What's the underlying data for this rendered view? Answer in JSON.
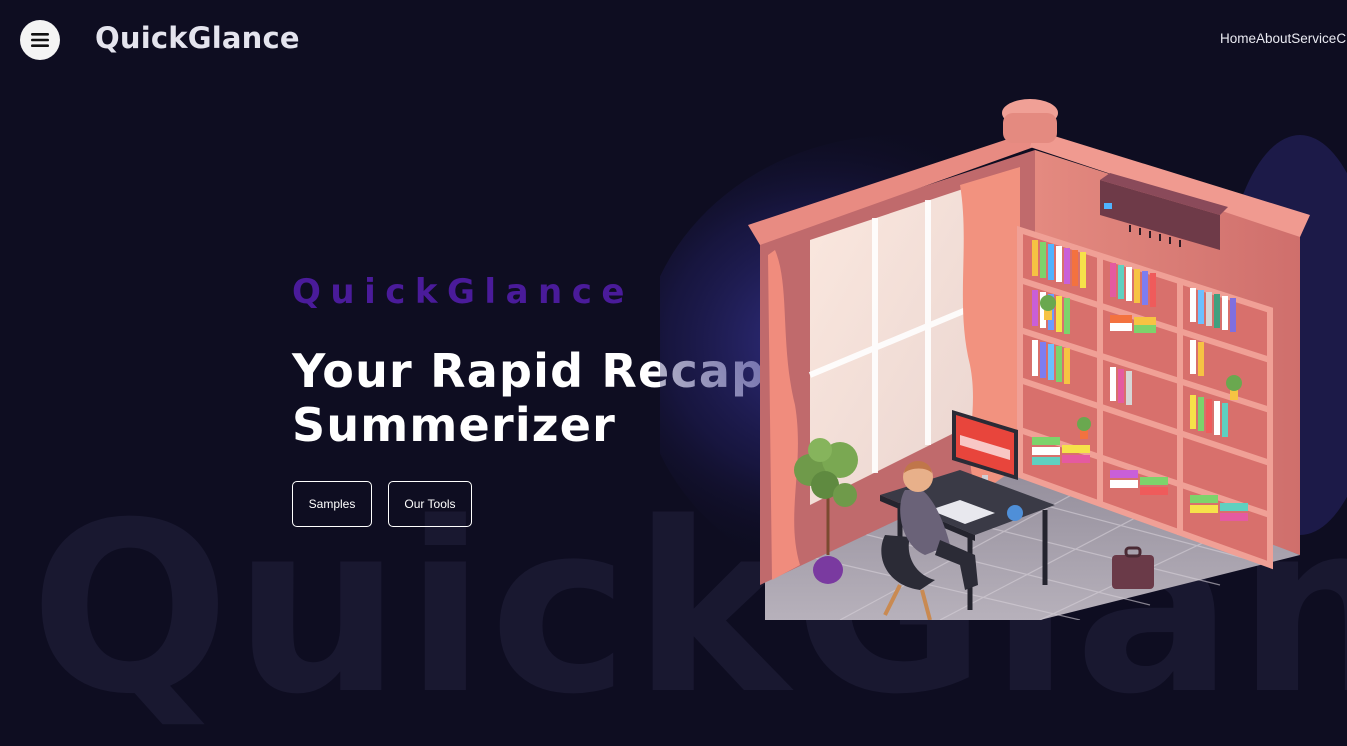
{
  "header": {
    "brand": "QuickGlance",
    "menu_icon": "hamburger-menu-icon",
    "nav": [
      "Home",
      "About",
      "Service",
      "C"
    ]
  },
  "hero": {
    "eyebrow": "QuickGlance",
    "headline_line1": "Your Rapid Recap",
    "headline_line2": "Summerizer",
    "buttons": {
      "samples": "Samples",
      "tools": "Our Tools"
    },
    "watermark": "QuickGlance"
  },
  "colors": {
    "background": "#0e0d21",
    "eyebrow": "#4a1b9a",
    "room_wall": "#e07a74",
    "glow": "#3d3aa0"
  }
}
